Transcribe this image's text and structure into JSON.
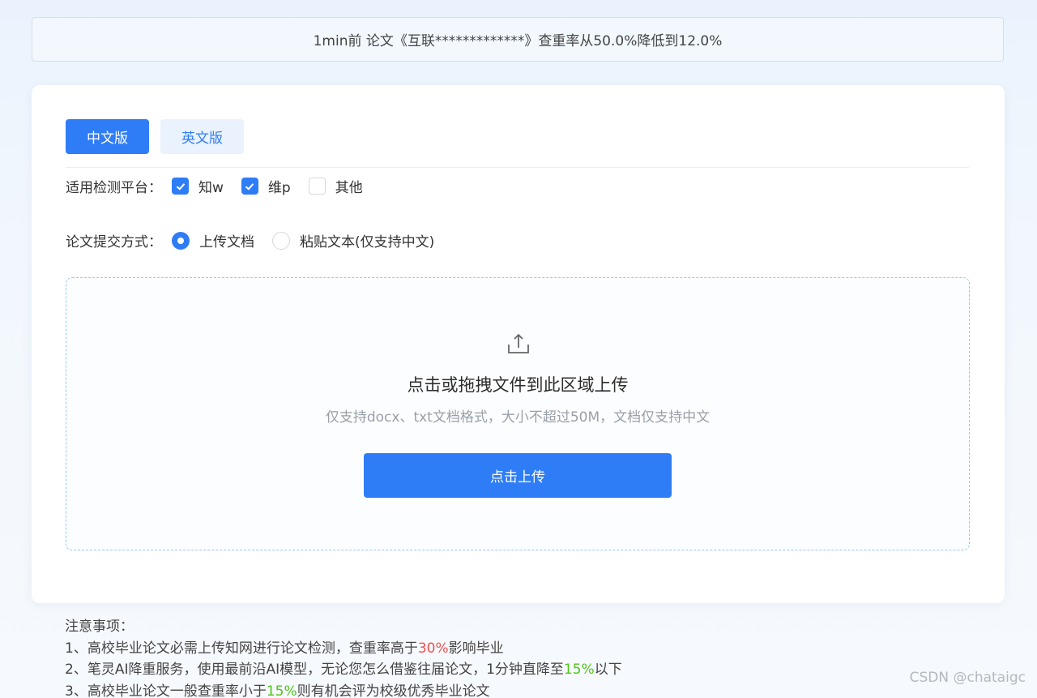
{
  "banner": {
    "text": "1min前 论文《互联*************》查重率从50.0%降低到12.0%"
  },
  "tabs": [
    {
      "label": "中文版",
      "active": true
    },
    {
      "label": "英文版",
      "active": false
    }
  ],
  "platform": {
    "label": "适用检测平台：",
    "options": [
      {
        "label": "知w",
        "checked": true
      },
      {
        "label": "维p",
        "checked": true
      },
      {
        "label": "其他",
        "checked": false
      }
    ]
  },
  "method": {
    "label": "论文提交方式：",
    "options": [
      {
        "label": "上传文档",
        "selected": true
      },
      {
        "label": "粘贴文本(仅支持中文)",
        "selected": false
      }
    ]
  },
  "upload": {
    "icon": "upload-icon",
    "title": "点击或拖拽文件到此区域上传",
    "hint": "仅支持docx、txt文档格式，大小不超过50M，文档仅支持中文",
    "button_label": "点击上传"
  },
  "notes": {
    "heading": "注意事项：",
    "items": [
      {
        "before": "1、高校毕业论文必需上传知网进行论文检测，查重率高于",
        "highlight": "30%",
        "after": "影响毕业"
      },
      {
        "before": "2、笔灵AI降重服务，使用最前沿AI模型，无论您怎么借鉴往届论文，1分钟直降至",
        "highlight": "15%",
        "after": "以下"
      },
      {
        "before": "3、高校毕业论文一般查重率小于",
        "highlight": "15%",
        "after": "则有机会评为校级优秀毕业论文"
      }
    ]
  },
  "colors": {
    "accent": "#2f7df6",
    "warning": "#f05050",
    "success": "#52c41a"
  },
  "watermark": "CSDN @chataigc"
}
